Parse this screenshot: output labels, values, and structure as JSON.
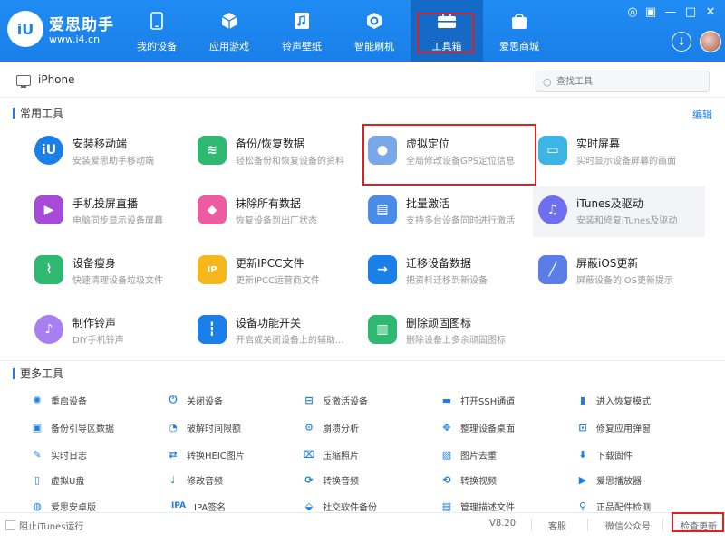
{
  "header": {
    "brand_name": "爱思助手",
    "brand_url": "www.i4.cn",
    "logo_text": "iU",
    "tabs": [
      {
        "label": "我的设备",
        "icon": "phone-icon"
      },
      {
        "label": "应用游戏",
        "icon": "cube-icon"
      },
      {
        "label": "铃声壁纸",
        "icon": "music-file-icon"
      },
      {
        "label": "智能刷机",
        "icon": "flash-gear-icon"
      },
      {
        "label": "工具箱",
        "icon": "toolbox-icon",
        "active": true
      },
      {
        "label": "爱思商城",
        "icon": "shopping-bag-icon"
      }
    ],
    "window_controls": [
      "◎",
      "▣",
      "—",
      "✕"
    ],
    "accent": "#1a7fe8"
  },
  "device_bar": {
    "device_name": "iPhone",
    "search_placeholder": "查找工具"
  },
  "common_section": {
    "title": "常用工具",
    "edit_label": "编辑",
    "tools": [
      {
        "title": "安装移动端",
        "desc": "安装爱思助手移动端",
        "icon": "iu-logo-icon",
        "color": "#1a7fe8"
      },
      {
        "title": "备份/恢复数据",
        "desc": "轻松备份和恢复设备的资料",
        "icon": "layers-icon",
        "color": "#2eb872"
      },
      {
        "title": "虚拟定位",
        "desc": "全局修改设备GPS定位信息",
        "icon": "location-pin-icon",
        "color": "#7aa7e8"
      },
      {
        "title": "实时屏幕",
        "desc": "实时显示设备屏幕的画面",
        "icon": "screens-icon",
        "color": "#3cb4e6"
      },
      {
        "title": "手机投屏直播",
        "desc": "电脑同步显示设备屏幕",
        "icon": "cast-screen-icon",
        "color": "#a64ad8"
      },
      {
        "title": "抹除所有数据",
        "desc": "恢复设备到出厂状态",
        "icon": "eraser-icon",
        "color": "#ef5ba1"
      },
      {
        "title": "批量激活",
        "desc": "支持多台设备同时进行激活",
        "icon": "batch-activate-icon",
        "color": "#4a8be8"
      },
      {
        "title": "iTunes及驱动",
        "desc": "安装和修复iTunes及驱动",
        "icon": "itunes-icon",
        "color": "#6f6ef0"
      },
      {
        "title": "设备瘦身",
        "desc": "快速清理设备垃圾文件",
        "icon": "broom-icon",
        "color": "#2eb872"
      },
      {
        "title": "更新IPCC文件",
        "desc": "更新IPCC运营商文件",
        "icon": "ipcc-icon",
        "color": "#f5b71c"
      },
      {
        "title": "迁移设备数据",
        "desc": "把资料迁移到新设备",
        "icon": "migrate-icon",
        "color": "#1a7fe8"
      },
      {
        "title": "屏蔽iOS更新",
        "desc": "屏蔽设备的iOS更新提示",
        "icon": "block-update-icon",
        "color": "#5b7de8"
      },
      {
        "title": "制作铃声",
        "desc": "DIY手机铃声",
        "icon": "ringtone-icon",
        "color": "#a77ff0"
      },
      {
        "title": "设备功能开关",
        "desc": "开启或关闭设备上的辅助...",
        "icon": "switches-icon",
        "color": "#1a7fe8"
      },
      {
        "title": "删除顽固图标",
        "desc": "删除设备上多余顽固图标",
        "icon": "trash-icon",
        "color": "#2eb872"
      }
    ]
  },
  "more_section": {
    "title": "更多工具",
    "tools": [
      {
        "label": "重启设备",
        "icon": "restart-icon"
      },
      {
        "label": "关闭设备",
        "icon": "power-icon"
      },
      {
        "label": "反激活设备",
        "icon": "deactivate-icon"
      },
      {
        "label": "打开SSH通道",
        "icon": "ssh-icon"
      },
      {
        "label": "进入恢复模式",
        "icon": "recovery-mode-icon"
      },
      {
        "label": "备份引导区数据",
        "icon": "backup-boot-icon"
      },
      {
        "label": "破解时间限额",
        "icon": "clock-icon"
      },
      {
        "label": "崩溃分析",
        "icon": "crash-analysis-icon"
      },
      {
        "label": "整理设备桌面",
        "icon": "organize-desktop-icon"
      },
      {
        "label": "修复应用弹窗",
        "icon": "fix-popup-icon"
      },
      {
        "label": "实时日志",
        "icon": "log-icon"
      },
      {
        "label": "转换HEIC图片",
        "icon": "heic-icon"
      },
      {
        "label": "压缩照片",
        "icon": "compress-photo-icon"
      },
      {
        "label": "图片去重",
        "icon": "dedupe-image-icon"
      },
      {
        "label": "下载固件",
        "icon": "download-firmware-icon"
      },
      {
        "label": "虚拟U盘",
        "icon": "usb-drive-icon"
      },
      {
        "label": "修改音频",
        "icon": "edit-audio-icon"
      },
      {
        "label": "转换音频",
        "icon": "convert-audio-icon"
      },
      {
        "label": "转换视频",
        "icon": "convert-video-icon"
      },
      {
        "label": "爱思播放器",
        "icon": "player-icon"
      },
      {
        "label": "爱思安卓版",
        "icon": "android-icon"
      },
      {
        "label": "IPA签名",
        "icon": "ipa-icon"
      },
      {
        "label": "社交软件备份",
        "icon": "social-backup-icon"
      },
      {
        "label": "管理描述文件",
        "icon": "profile-icon"
      },
      {
        "label": "正品配件检测",
        "icon": "accessory-check-icon"
      }
    ]
  },
  "footer": {
    "block_itunes_label": "阻止iTunes运行",
    "version": "V8.20",
    "feedback": "客服",
    "wechat": "微信公众号",
    "check_update": "检查更新"
  }
}
